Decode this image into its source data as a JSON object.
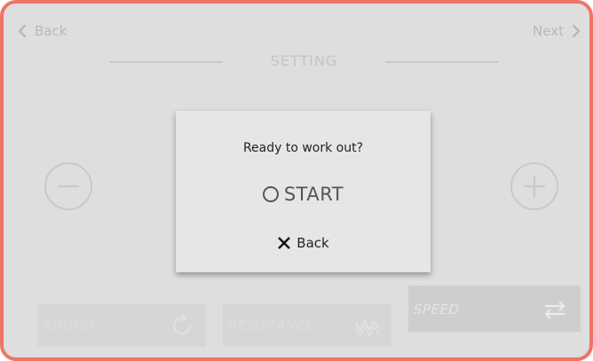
{
  "nav": {
    "back_label": "Back",
    "next_label": "Next"
  },
  "header": {
    "title": "SETTING"
  },
  "controls": {
    "decrement_icon": "minus-circle-icon",
    "increment_icon": "plus-circle-icon"
  },
  "modes": {
    "round_label": "ROUND",
    "round_icon": "refresh-icon",
    "resistance_label": "RESISTANCE",
    "resistance_icon": "wave-icon",
    "speed_label": "SPEED",
    "speed_icon": "swap-arrows-icon"
  },
  "dialog": {
    "title": "Ready to work out?",
    "start_label": "START",
    "start_icon": "radio-circle-icon",
    "back_label": "Back",
    "back_icon": "close-icon"
  },
  "colors": {
    "frame": "#ee7467",
    "background": "#dedede",
    "dialog": "#e6e6e6"
  }
}
